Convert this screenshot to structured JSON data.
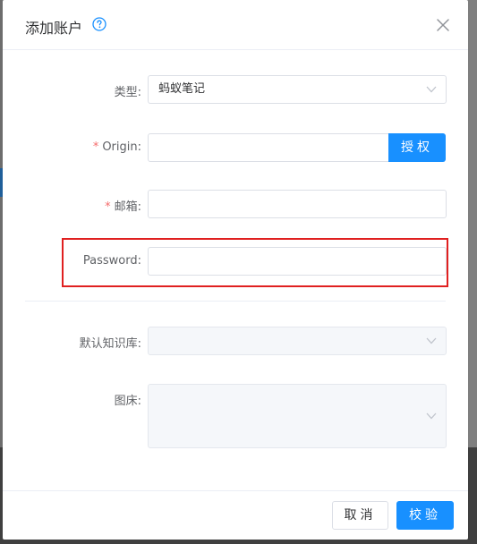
{
  "dialog": {
    "title": "添加账户"
  },
  "form": {
    "type": {
      "label": "类型:",
      "value": "蚂蚁笔记"
    },
    "origin": {
      "label": "Origin:",
      "required_mark": "*",
      "value": "",
      "auth_button": "授权"
    },
    "email": {
      "label": "邮箱:",
      "required_mark": "*",
      "value": ""
    },
    "password": {
      "label": "Password:",
      "value": ""
    },
    "notebook": {
      "label": "默认知识库:",
      "value": ""
    },
    "image_host": {
      "label": "图床:",
      "value": ""
    }
  },
  "footer": {
    "cancel_label": "取消",
    "verify_label": "校验"
  },
  "colors": {
    "primary": "#1890ff",
    "required": "#f56c6c",
    "highlight": "#e02020"
  },
  "icons": {
    "help": "question-circle-icon",
    "close": "close-icon",
    "select": "chevron-down-icon"
  }
}
